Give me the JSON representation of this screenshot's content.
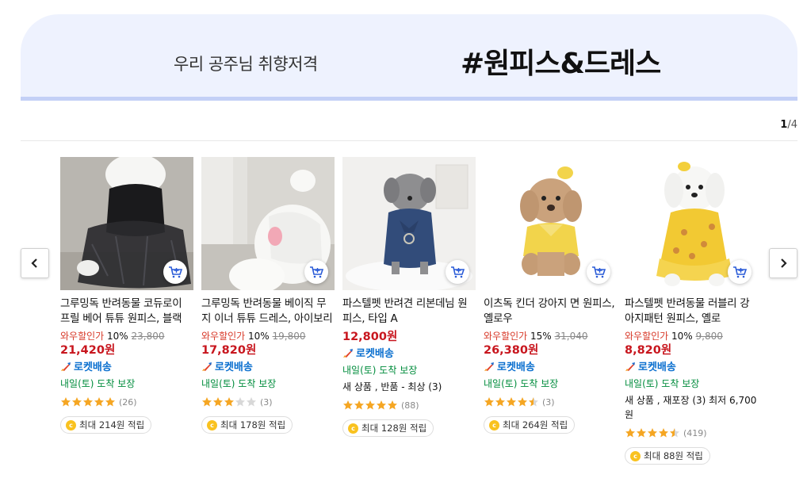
{
  "banner": {
    "subtitle": "우리 공주님 취향저격",
    "title": "#원피스&드레스"
  },
  "pager": {
    "current": "1",
    "total": "/4"
  },
  "products": [
    {
      "name": "그루밍독 반려동물 코듀로이 프릴 베어 튜튜 원피스, 블랙",
      "wow_label": "와우할인가",
      "discount": " 10% ",
      "old_price": "23,800",
      "price": "21,420원",
      "rocket": "로켓배송",
      "arrival": "내일(토) 도착 보장",
      "extra": "",
      "rating": 5,
      "review_count": "(26)",
      "reward": "최대 214원 적립"
    },
    {
      "name": "그루밍독 반려동물 베이직 무지 이너 튜튜 드레스, 아이보리",
      "wow_label": "와우할인가",
      "discount": " 10% ",
      "old_price": "19,800",
      "price": "17,820원",
      "rocket": "로켓배송",
      "arrival": "내일(토) 도착 보장",
      "extra": "",
      "rating": 3,
      "review_count": "(3)",
      "reward": "최대 178원 적립"
    },
    {
      "name": "파스텔펫 반려견 리본데님 원피스, 타입 A",
      "wow_label": "",
      "discount": "",
      "old_price": "",
      "price": "12,800원",
      "rocket": "로켓배송",
      "arrival": "내일(토) 도착 보장",
      "extra": "새 상품 , 반품 - 최상 (3)",
      "rating": 5,
      "review_count": "(88)",
      "reward": "최대 128원 적립"
    },
    {
      "name": "이츠독 킨더 강아지 면 원피스, 옐로우",
      "wow_label": "와우할인가",
      "discount": " 15% ",
      "old_price": "31,040",
      "price": "26,380원",
      "rocket": "로켓배송",
      "arrival": "내일(토) 도착 보장",
      "extra": "",
      "rating": 4.5,
      "review_count": "(3)",
      "reward": "최대 264원 적립"
    },
    {
      "name": "파스텔펫 반려동물 러블리 강아지패턴 원피스, 옐로",
      "wow_label": "와우할인가",
      "discount": " 10% ",
      "old_price": "9,800",
      "price": "8,820원",
      "rocket": "로켓배송",
      "arrival": "내일(토) 도착 보장",
      "extra": "새 상품 , 재포장 (3) 최저 6,700 원",
      "rating": 4.5,
      "review_count": "(419)",
      "reward": "최대 88원 적립"
    }
  ],
  "icons": {
    "cart": "add-to-cart-icon",
    "rocket": "rocket-icon",
    "star": "star-icon",
    "coin": "coin-icon",
    "prev": "chevron-left-icon",
    "next": "chevron-right-icon"
  },
  "colors": {
    "price": "#c8161e",
    "rocket": "#0a6fcf",
    "arrival": "#008c3c",
    "star": "#f5a623",
    "coin": "#f9c21f"
  }
}
